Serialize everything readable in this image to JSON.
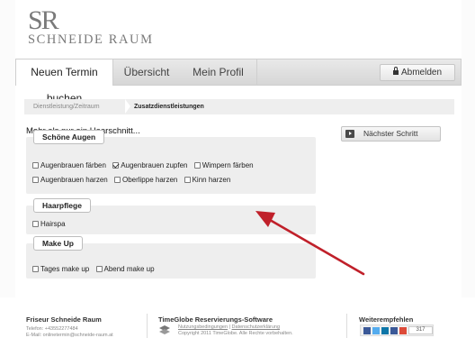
{
  "logo": {
    "mark": "SR",
    "name": "SCHNEIDE RAUM"
  },
  "nav": {
    "tabs": [
      {
        "label": "Neuen Termin buchen",
        "active": true
      },
      {
        "label": "Übersicht",
        "active": false
      },
      {
        "label": "Mein Profil",
        "active": false
      }
    ],
    "logout_label": "Abmelden"
  },
  "breadcrumb": [
    "Dienstleistung/Zeitraum",
    "Zusatzdienstleistungen"
  ],
  "main": {
    "heading": "Mehr als nur ein Haarschnitt...",
    "groups": [
      {
        "title": "Schöne Augen",
        "rows": [
          [
            {
              "label": "Augenbrauen färben",
              "checked": false
            },
            {
              "label": "Augenbrauen zupfen",
              "checked": true
            },
            {
              "label": "Wimpern färben",
              "checked": false
            }
          ],
          [
            {
              "label": "Augenbrauen harzen",
              "checked": false
            },
            {
              "label": "Oberlippe harzen",
              "checked": false
            },
            {
              "label": "Kinn harzen",
              "checked": false
            }
          ]
        ]
      },
      {
        "title": "Haarpflege",
        "rows": [
          [
            {
              "label": "Hairspa",
              "checked": false
            }
          ]
        ]
      },
      {
        "title": "Make Up",
        "rows": [
          [
            {
              "label": "Tages make up",
              "checked": false
            },
            {
              "label": "Abend make up",
              "checked": false
            }
          ]
        ]
      }
    ],
    "next_label": "Nächster Schritt"
  },
  "annotation": {
    "arrow_color": "#c0202a"
  },
  "footer": {
    "salon": {
      "title": "Friseur Schneide Raum",
      "phone": "Telefon: +43552277484",
      "email": "E-Mail: onlinetermin@schneide-raum.at"
    },
    "software": {
      "title": "TimeGlobe Reservierungs-Software",
      "links": [
        "Nutzungsbedingungen",
        "Datenschutzerklärung"
      ],
      "separator": "|",
      "copyright": "Copyright 2011 TimeGlobe. Alle Rechte vorbehalten."
    },
    "recommend": {
      "title": "Weiterempfehlen",
      "count": "317",
      "colors": [
        "#3b5998",
        "#55acee",
        "#0e76a8",
        "#3b5998",
        "#dd4b39"
      ]
    }
  }
}
